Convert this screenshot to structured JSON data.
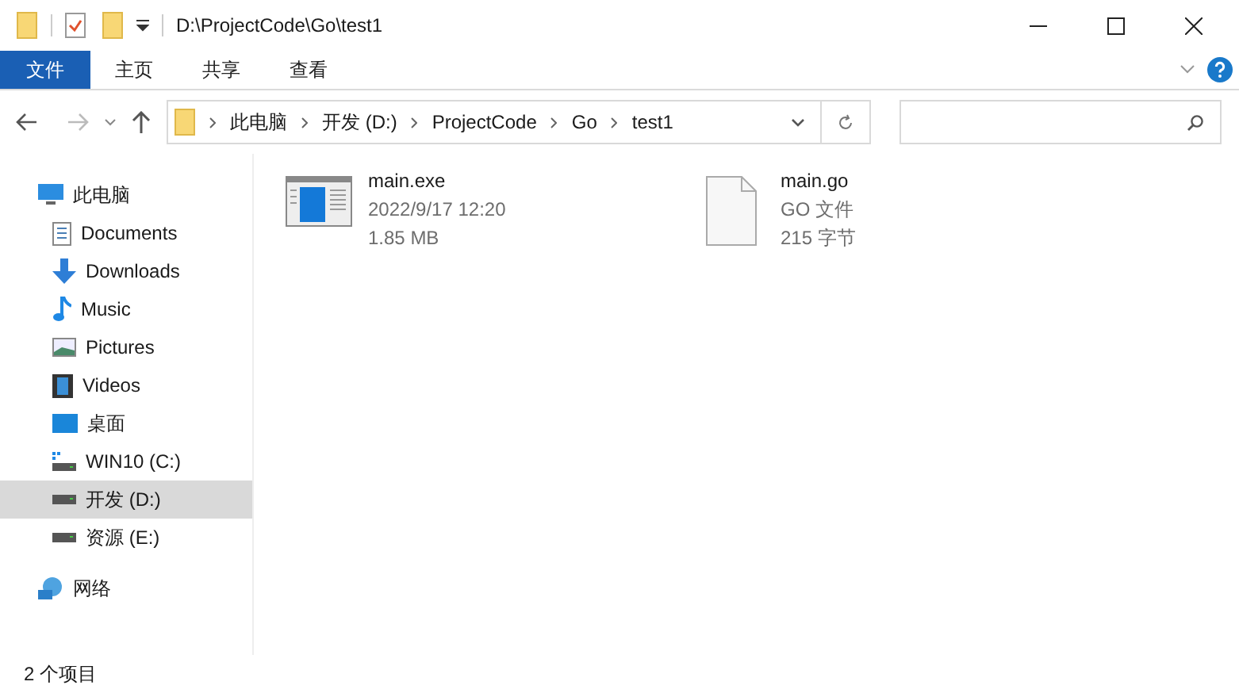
{
  "window": {
    "title": "D:\\ProjectCode\\Go\\test1"
  },
  "ribbon_tabs": [
    {
      "label": "文件",
      "selected": true
    },
    {
      "label": "主页",
      "selected": false
    },
    {
      "label": "共享",
      "selected": false
    },
    {
      "label": "查看",
      "selected": false
    }
  ],
  "address_bar": {
    "segments": [
      "此电脑",
      "开发 (D:)",
      "ProjectCode",
      "Go",
      "test1"
    ]
  },
  "sidebar": {
    "items": [
      {
        "label": "此电脑",
        "kind": "computer",
        "selected": false,
        "children": [
          {
            "label": "Documents",
            "kind": "documents",
            "selected": false
          },
          {
            "label": "Downloads",
            "kind": "downloads",
            "selected": false
          },
          {
            "label": "Music",
            "kind": "music",
            "selected": false
          },
          {
            "label": "Pictures",
            "kind": "pictures",
            "selected": false
          },
          {
            "label": "Videos",
            "kind": "videos",
            "selected": false
          },
          {
            "label": "桌面",
            "kind": "desktop",
            "selected": false
          },
          {
            "label": "WIN10 (C:)",
            "kind": "system-drive",
            "selected": false
          },
          {
            "label": "开发 (D:)",
            "kind": "drive",
            "selected": true
          },
          {
            "label": "资源 (E:)",
            "kind": "drive",
            "selected": false
          }
        ]
      },
      {
        "label": "网络",
        "kind": "network",
        "selected": false
      }
    ]
  },
  "files": [
    {
      "name": "main.exe",
      "kind": "exe",
      "line_1": "2022/9/17 12:20",
      "line_2": "1.85 MB"
    },
    {
      "name": "main.go",
      "kind": "document",
      "line_1": "GO 文件",
      "line_2": "215 字节"
    }
  ],
  "status_bar": {
    "count": "2 个项目"
  }
}
